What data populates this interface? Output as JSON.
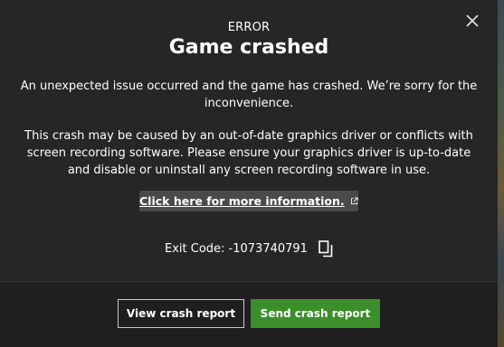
{
  "dialog": {
    "eyebrow": "ERROR",
    "title": "Game crashed",
    "message_1": "An unexpected issue occurred and the game has crashed. We’re sorry for the inconvenience.",
    "message_2": "This crash may be caused by an out-of-date graphics driver or conflicts with screen recording software. Please ensure your graphics driver is up-to-date and disable or uninstall any screen recording software in use.",
    "info_link": "Click here for more information.",
    "exit_code_label": "Exit Code: -1073740791"
  },
  "buttons": {
    "view_crash_report": "View crash report",
    "send_crash_report": "Send crash report"
  },
  "icons": {
    "close": "close-icon",
    "external_link": "external-link-icon",
    "copy": "copy-icon"
  },
  "colors": {
    "dialog_bg": "#262626",
    "footer_bg": "#1f1f1f",
    "primary_button": "#3b8f2b",
    "link_chip_bg": "#4a4a4a",
    "text": "#ffffff"
  }
}
